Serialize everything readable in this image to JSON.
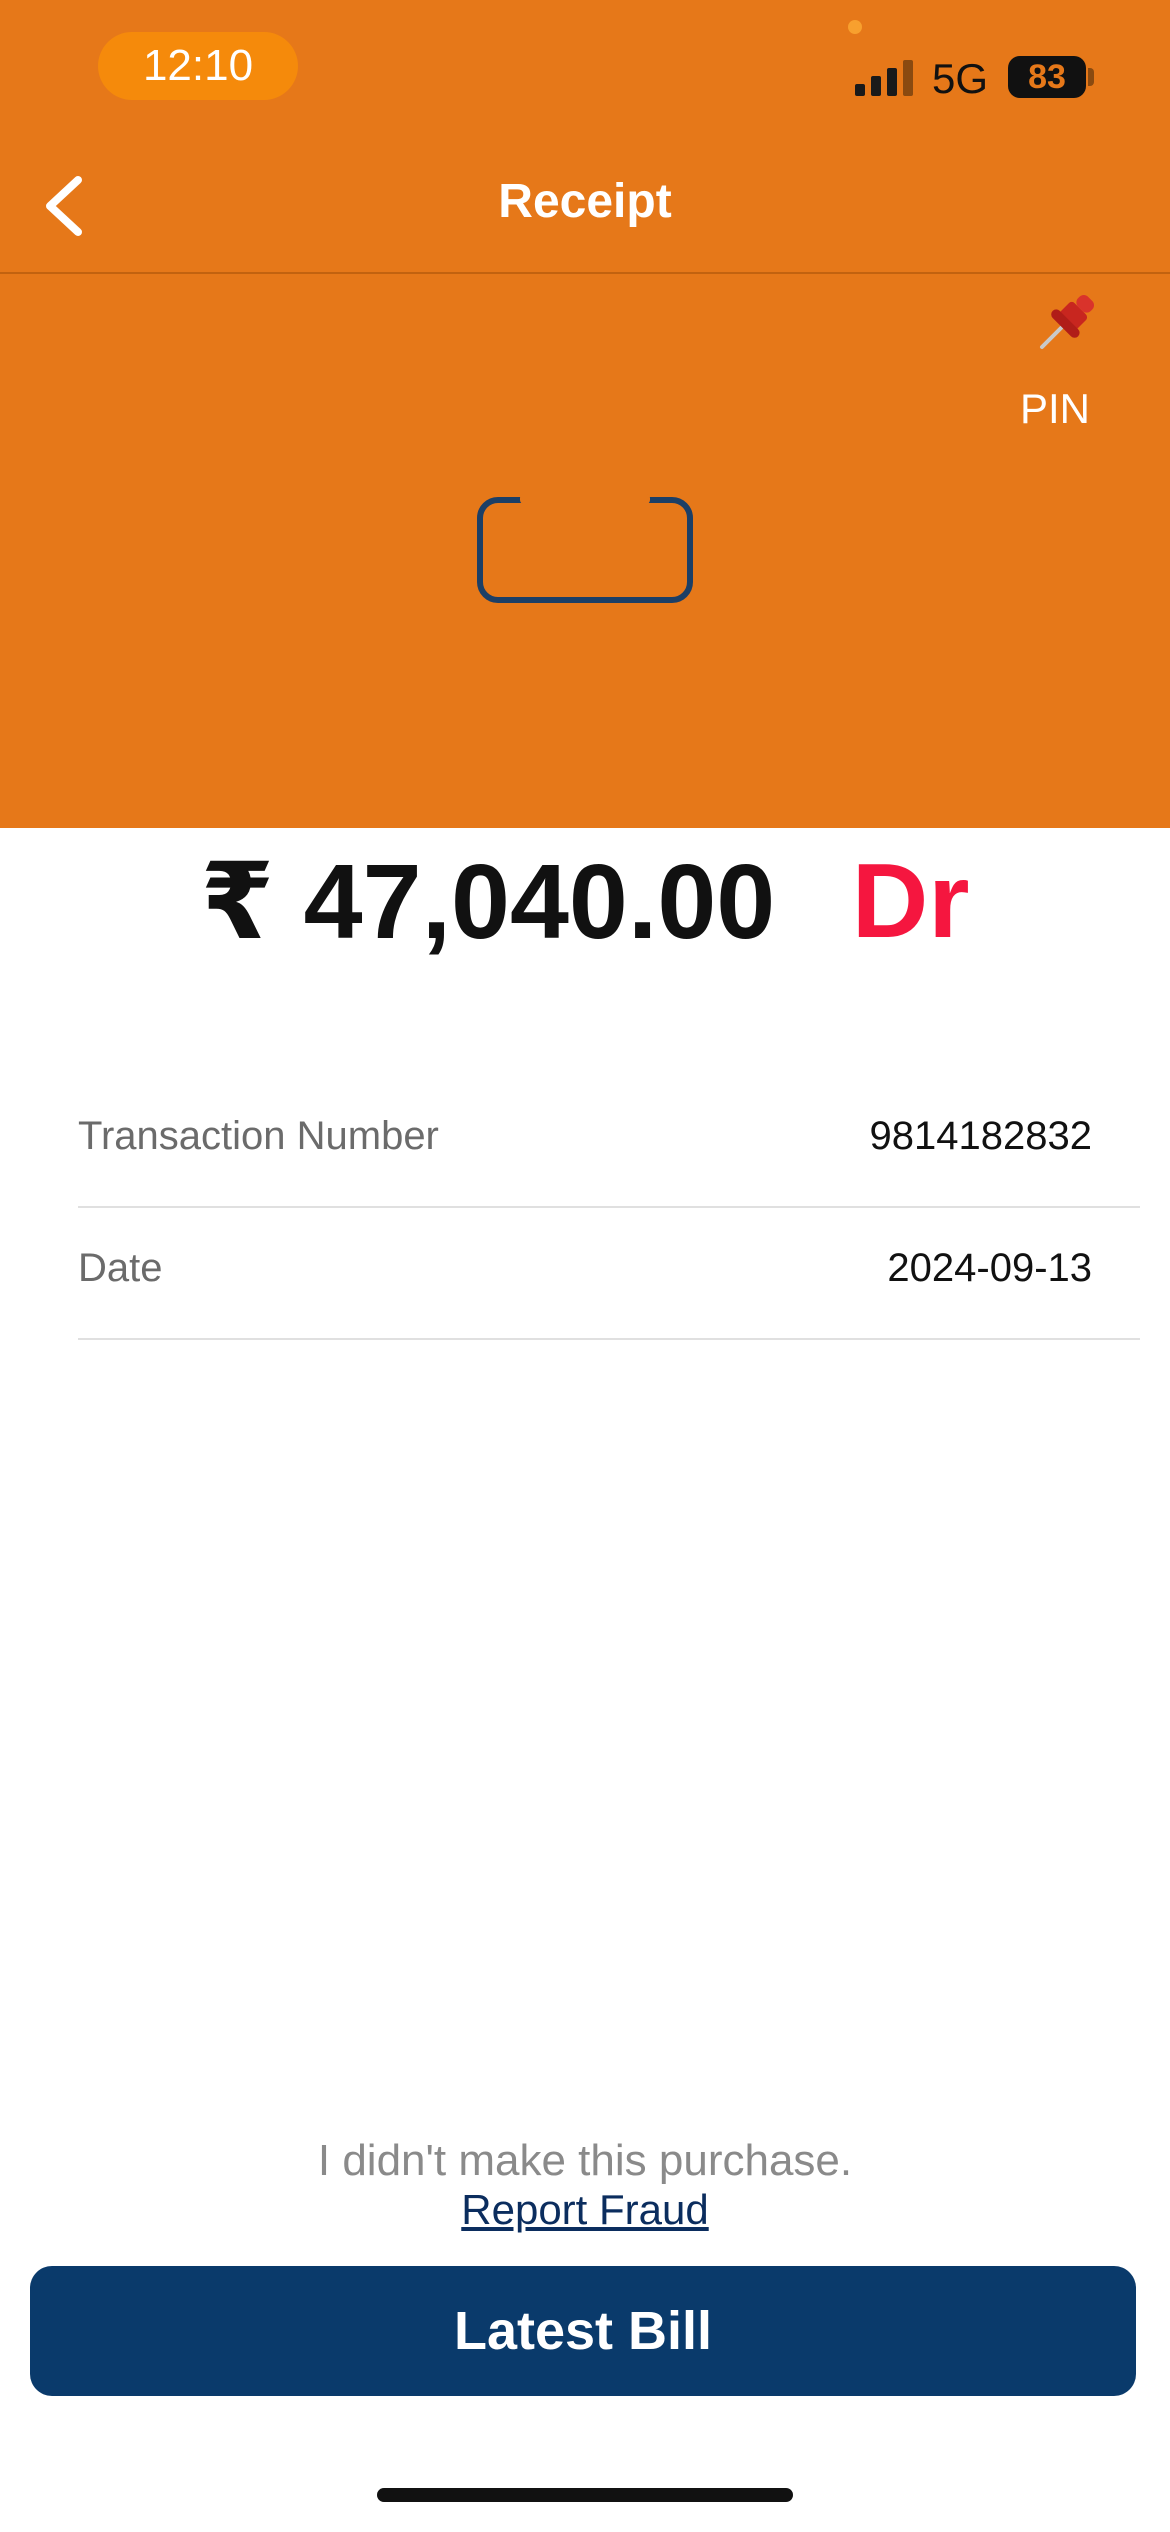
{
  "status_bar": {
    "time": "12:10",
    "network": "5G",
    "battery": "83",
    "signal_bars_active": 3,
    "signal_bars_total": 4
  },
  "nav": {
    "title": "Receipt",
    "back_icon": "chevron-left-icon"
  },
  "pin": {
    "label": "PIN",
    "icon": "pushpin-icon"
  },
  "merchant_icon": "card-icon",
  "transaction": {
    "amount": "₹ 47,040.00",
    "type": "Dr"
  },
  "details": [
    {
      "label": "Transaction Number",
      "value": "9814182832"
    },
    {
      "label": "Date",
      "value": "2024-09-13"
    }
  ],
  "fraud": {
    "text": "I didn't make this purchase.",
    "link": "Report Fraud"
  },
  "primary_button": {
    "label": "Latest Bill"
  },
  "colors": {
    "header_bg": "#e67819",
    "button_bg": "#0a3a6b",
    "debit_red": "#f5163f"
  }
}
